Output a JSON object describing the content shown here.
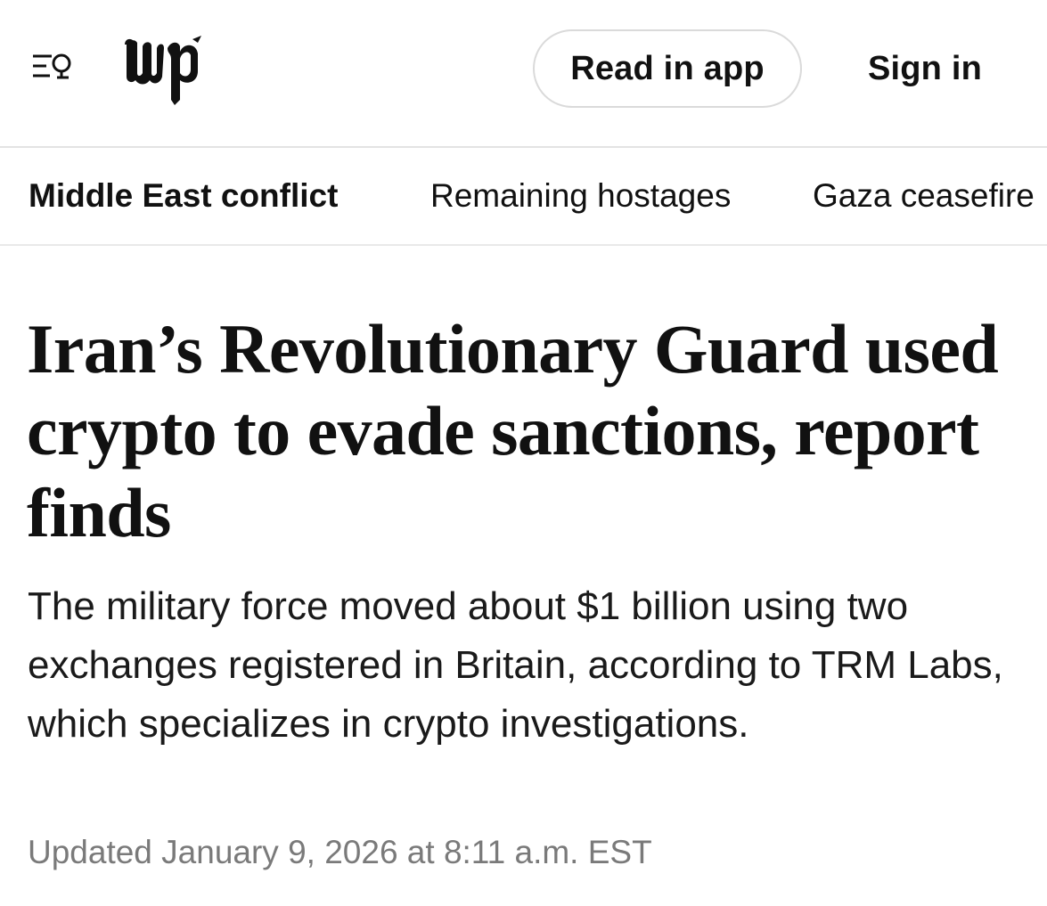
{
  "header": {
    "menu_icon": "menu-search-icon",
    "logo_text": "wp",
    "read_in_app_label": "Read in app",
    "sign_in_label": "Sign in"
  },
  "subnav": {
    "items": [
      {
        "label": "Middle East conflict",
        "active": true
      },
      {
        "label": "Remaining hostages",
        "active": false
      },
      {
        "label": "Gaza ceasefire",
        "active": false
      }
    ]
  },
  "article": {
    "headline": "Iran’s Revolutionary Guard used crypto to evade sanctions, report finds",
    "dek": "The military force moved about $1 billion using two exchanges registered in Britain, according to TRM Labs, which specializes in crypto investigations.",
    "timestamp": "Updated January 9, 2026 at 8:11 a.m. EST"
  },
  "colors": {
    "text": "#111111",
    "muted": "#7a7a7a",
    "divider": "#e3e3e3",
    "button_border": "#dadada"
  }
}
